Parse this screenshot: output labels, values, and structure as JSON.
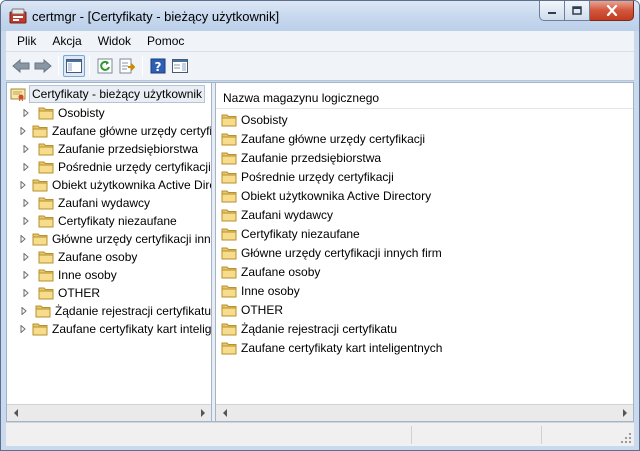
{
  "window": {
    "title": "certmgr - [Certyfikaty - bieżący użytkownik]",
    "accent": "#c9d9ee"
  },
  "menu": [
    "Plik",
    "Akcja",
    "Widok",
    "Pomoc"
  ],
  "toolbar": {
    "icons": [
      "back-arrow-icon",
      "forward-arrow-icon",
      "show-hide-tree-icon",
      "refresh-icon",
      "export-list-icon",
      "help-icon",
      "action-pane-icon"
    ]
  },
  "tree": {
    "root": "Certyfikaty - bieżący użytkownik",
    "items": [
      "Osobisty",
      "Zaufane główne urzędy certyfikacji",
      "Zaufanie przedsiębiorstwa",
      "Pośrednie urzędy certyfikacji",
      "Obiekt użytkownika Active Directory",
      "Zaufani wydawcy",
      "Certyfikaty niezaufane",
      "Główne urzędy certyfikacji innych firm",
      "Zaufane osoby",
      "Inne osoby",
      "OTHER",
      "Żądanie rejestracji certyfikatu",
      "Zaufane certyfikaty kart inteligentnych"
    ]
  },
  "list": {
    "column_header": "Nazwa magazynu logicznego",
    "items": [
      "Osobisty",
      "Zaufane główne urzędy certyfikacji",
      "Zaufanie przedsiębiorstwa",
      "Pośrednie urzędy certyfikacji",
      "Obiekt użytkownika Active Directory",
      "Zaufani wydawcy",
      "Certyfikaty niezaufane",
      "Główne urzędy certyfikacji innych firm",
      "Zaufane osoby",
      "Inne osoby",
      "OTHER",
      "Żądanie rejestracji certyfikatu",
      "Zaufane certyfikaty kart inteligentnych"
    ]
  }
}
